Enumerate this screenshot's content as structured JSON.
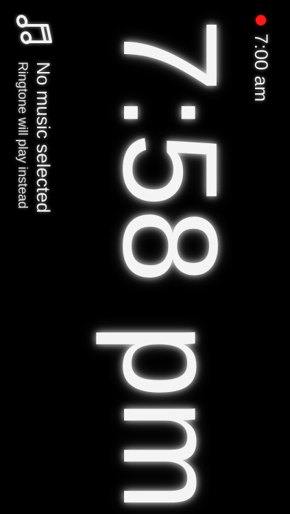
{
  "alarm": {
    "indicator_color": "#ff1a1a",
    "time": "7:00 am"
  },
  "clock": {
    "time": "7:58 pm"
  },
  "music": {
    "icon": "music-note-icon",
    "title": "No music selected",
    "subtitle": "Ringtone will play instead"
  }
}
